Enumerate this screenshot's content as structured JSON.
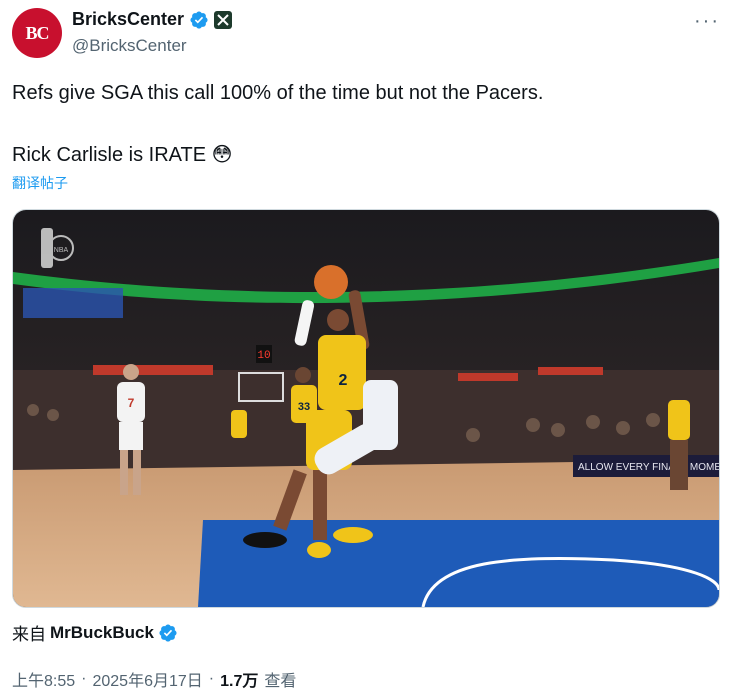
{
  "header": {
    "display_name": "BricksCenter",
    "handle": "@BricksCenter",
    "avatar_text": "BC",
    "more_icon": "more-horizontal-icon"
  },
  "tweet": {
    "line1": "Refs give SGA this call 100% of the time but not the Pacers.",
    "line2": "Rick Carlisle is IRATE",
    "emoji": "😳",
    "translate_label": "翻译帖子"
  },
  "media": {
    "watermark": "NBA",
    "jersey_main": "2",
    "jersey_left": "7",
    "jersey_mid": "33",
    "shot_clock": "10",
    "banner_text": "ALLOW EVERY FINALS MOMENT #Fin ALLOW"
  },
  "source": {
    "prefix": "来自",
    "name": "MrBuckBuck"
  },
  "meta": {
    "time": "上午8:55",
    "date": "2025年6月17日",
    "views_count": "1.7万",
    "views_label": "查看",
    "sep1": "·",
    "sep2": "·"
  },
  "colors": {
    "verified_blue": "#1d9bf0",
    "brand_red": "#c8102e",
    "court_blue": "#1e5bb8",
    "pacers_yellow": "#f0c419"
  }
}
